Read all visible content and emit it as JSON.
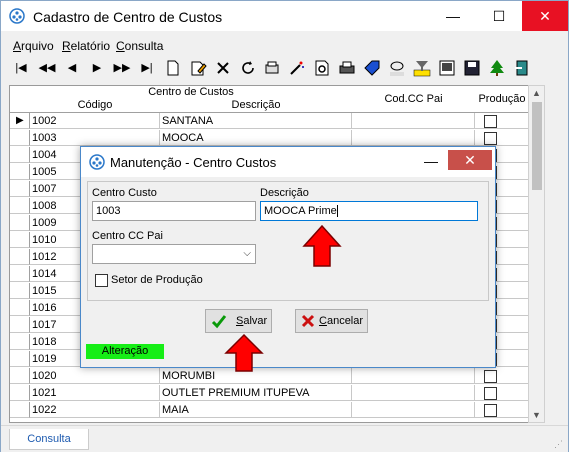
{
  "window": {
    "title": "Cadastro de Centro de Custos",
    "minimize": "—",
    "maximize": "☐",
    "close": "✕"
  },
  "menu": {
    "arquivo": {
      "first": "A",
      "rest": "rquivo"
    },
    "relatorio": {
      "first": "R",
      "rest": "elatório"
    },
    "consulta": {
      "first": "C",
      "rest": "onsulta"
    }
  },
  "toolbar": {
    "icons": [
      "first-record-icon",
      "prev-page-icon",
      "prev-record-icon",
      "next-record-icon",
      "next-page-icon",
      "last-record-icon",
      "new-document-icon",
      "edit-document-icon",
      "delete-icon",
      "refresh-icon",
      "print-settings-icon",
      "magic-wand-icon",
      "print-preview-icon",
      "printer-icon",
      "tag-icon",
      "goto-icon",
      "filter-icon",
      "image-icon",
      "save-disk-icon",
      "tree-icon",
      "exit-icon"
    ]
  },
  "grid": {
    "group_header": "Centro de Custos",
    "col_codigo": "Código",
    "col_descricao": "Descrição",
    "col_cc_pai": "Cod.CC Pai",
    "col_producao": "Produção",
    "rows": [
      {
        "codigo": "1002",
        "descricao": "SANTANA",
        "cc_pai": "",
        "producao": false
      },
      {
        "codigo": "1003",
        "descricao": "MOOCA",
        "cc_pai": "",
        "producao": false
      },
      {
        "codigo": "1004",
        "descricao": "",
        "cc_pai": "",
        "producao": false
      },
      {
        "codigo": "1005",
        "descricao": "",
        "cc_pai": "",
        "producao": false
      },
      {
        "codigo": "1007",
        "descricao": "",
        "cc_pai": "",
        "producao": false
      },
      {
        "codigo": "1008",
        "descricao": "",
        "cc_pai": "",
        "producao": false
      },
      {
        "codigo": "1009",
        "descricao": "",
        "cc_pai": "",
        "producao": false
      },
      {
        "codigo": "1010",
        "descricao": "",
        "cc_pai": "",
        "producao": false
      },
      {
        "codigo": "1012",
        "descricao": "",
        "cc_pai": "",
        "producao": false
      },
      {
        "codigo": "1014",
        "descricao": "",
        "cc_pai": "",
        "producao": false
      },
      {
        "codigo": "1015",
        "descricao": "",
        "cc_pai": "",
        "producao": false
      },
      {
        "codigo": "1016",
        "descricao": "",
        "cc_pai": "",
        "producao": false
      },
      {
        "codigo": "1017",
        "descricao": "",
        "cc_pai": "",
        "producao": false
      },
      {
        "codigo": "1018",
        "descricao": "",
        "cc_pai": "",
        "producao": false
      },
      {
        "codigo": "1019",
        "descricao": "",
        "cc_pai": "",
        "producao": false
      },
      {
        "codigo": "1020",
        "descricao": "MORUMBI",
        "cc_pai": "",
        "producao": false
      },
      {
        "codigo": "1021",
        "descricao": "OUTLET PREMIUM ITUPEVA",
        "cc_pai": "",
        "producao": false
      },
      {
        "codigo": "1022",
        "descricao": "MAIA",
        "cc_pai": "",
        "producao": false
      }
    ]
  },
  "statusbar": {
    "tab": "Consulta"
  },
  "dialog": {
    "title": "Manutenção - Centro Custos",
    "minimize": "—",
    "close": "✕",
    "centro_custo_label": "Centro Custo",
    "centro_custo_value": "1003",
    "descricao_label": "Descrição",
    "descricao_value": "MOOCA Prime",
    "cc_pai_label": "Centro CC Pai",
    "cc_pai_value": "",
    "setor_label": "Setor de Produção",
    "setor_checked": false,
    "salvar": {
      "first": "S",
      "rest": "alvar"
    },
    "cancelar": {
      "first": "C",
      "rest": "ancelar"
    },
    "mode_status": "Alteração"
  },
  "colors": {
    "accent": "#0078d7",
    "close_red": "#e81123",
    "status_green": "#16ee16",
    "arrow_red": "#ff0000"
  }
}
